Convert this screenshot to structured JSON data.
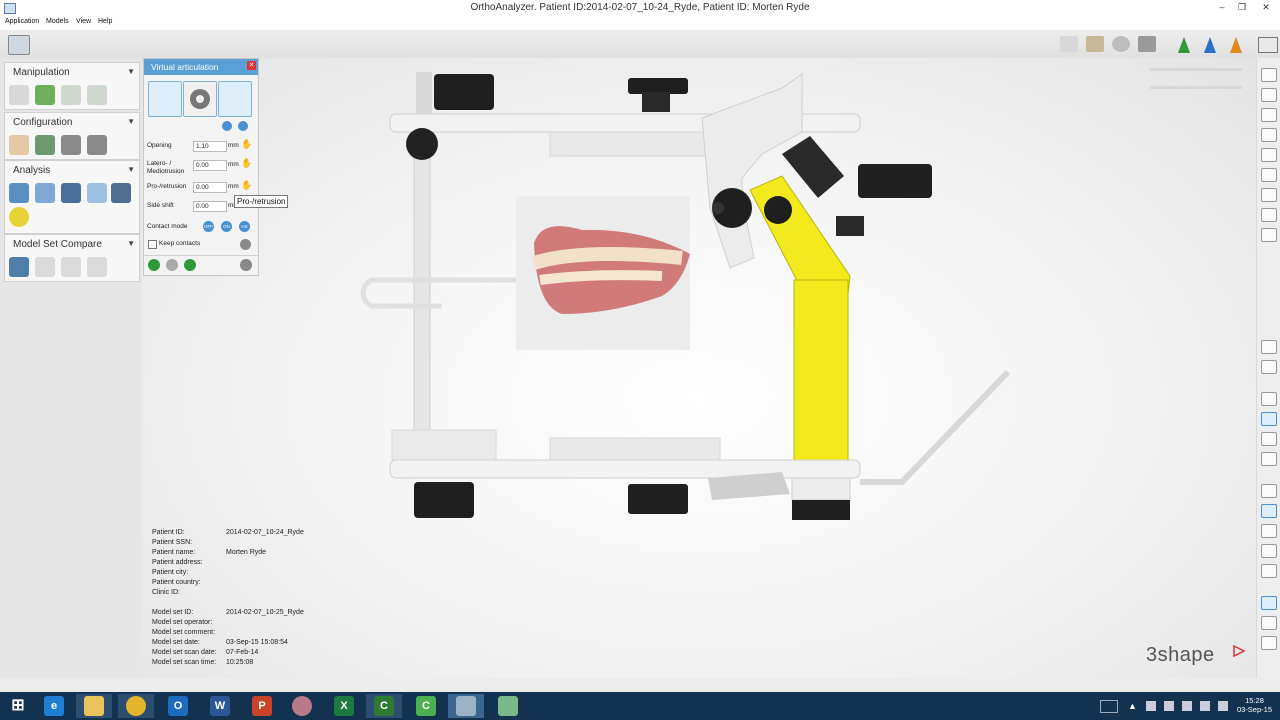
{
  "window": {
    "title": "OrthoAnalyzer. Patient ID:2014-02-07_10-24_Ryde, Patient ID: Morten Ryde",
    "minimize": "–",
    "maximize": "❐",
    "close": "✕"
  },
  "menu": [
    "Application",
    "Models",
    "View",
    "Help"
  ],
  "left_panel": {
    "sections": [
      {
        "title": "Manipulation"
      },
      {
        "title": "Configuration"
      },
      {
        "title": "Analysis"
      },
      {
        "title": "Model Set Compare"
      }
    ]
  },
  "virtual_articulation": {
    "title": "Virtual articulation",
    "fields": [
      {
        "label": "Opening",
        "value": "1.10",
        "unit": "mm"
      },
      {
        "label": "Latero- / Mediotrusion",
        "value": "0.00",
        "unit": "mm"
      },
      {
        "label": "Pro-/retrusion",
        "value": "0.00",
        "unit": "mm"
      },
      {
        "label": "Side shift",
        "value": "0.00",
        "unit": "mm"
      }
    ],
    "contact_mode_label": "Contact mode",
    "contact_modes": [
      "OFF",
      "ON",
      "HS"
    ],
    "keep_contacts_label": "Keep contacts",
    "tooltip": "Pro-/retrusion"
  },
  "patient_info": [
    {
      "label": "Patient ID:",
      "value": "2014-02-07_10-24_Ryde"
    },
    {
      "label": "Patient SSN:",
      "value": ""
    },
    {
      "label": "Patient name:",
      "value": "Morten Ryde"
    },
    {
      "label": "Patient address:",
      "value": ""
    },
    {
      "label": "Patient city:",
      "value": ""
    },
    {
      "label": "Patient country:",
      "value": ""
    },
    {
      "label": "Clinic ID:",
      "value": ""
    }
  ],
  "model_info": [
    {
      "label": "Model set ID:",
      "value": "2014-02-07_10-25_Ryde"
    },
    {
      "label": "Model set operator:",
      "value": ""
    },
    {
      "label": "Model set comment:",
      "value": ""
    },
    {
      "label": "Model set date:",
      "value": "03-Sep-15 15:08:54"
    },
    {
      "label": "Model set scan date:",
      "value": "07-Feb-14"
    },
    {
      "label": "Model set scan time:",
      "value": "10:25:08"
    }
  ],
  "brand": "3shape",
  "taskbar": {
    "time": "15:28",
    "date": "03-Sep-15"
  },
  "colors": {
    "panel_header": "#5aa0d6",
    "articulator_yellow": "#f2ea1d",
    "taskbar": "#13324f"
  }
}
